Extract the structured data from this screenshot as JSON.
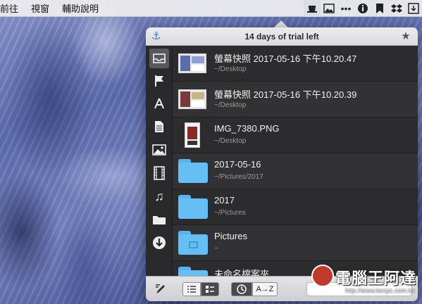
{
  "menubar": {
    "items": [
      "前往",
      "視窗",
      "輔助說明"
    ],
    "status_icons": [
      "hat-icon",
      "image-icon",
      "more-icon",
      "info-icon",
      "bookmark-icon",
      "dropbox-icon",
      "download-icon"
    ]
  },
  "popover": {
    "title": "14 days of trial left",
    "sidebar": [
      "tray-icon",
      "flag-icon",
      "apps-icon",
      "document-icon",
      "picture-icon",
      "film-icon",
      "music-icon",
      "folder-icon",
      "download-icon"
    ],
    "rows": [
      {
        "name": "螢幕快照 2017-05-16 下午10.20.47",
        "path": "~/Desktop",
        "thumb": "screenshot"
      },
      {
        "name": "螢幕快照 2017-05-16 下午10.20.39",
        "path": "~/Desktop",
        "thumb": "screenshot"
      },
      {
        "name": "IMG_7380.PNG",
        "path": "~/Desktop",
        "thumb": "portrait-image"
      },
      {
        "name": "2017-05-16",
        "path": "~/Pictures/2017",
        "thumb": "folder"
      },
      {
        "name": "2017",
        "path": "~/Pictures",
        "thumb": "folder"
      },
      {
        "name": "Pictures",
        "path": "~",
        "thumb": "pictures-folder"
      },
      {
        "name": "未命名檔案夾",
        "path": "",
        "thumb": "folder"
      }
    ],
    "toolbar": {
      "sort_label": "A→Z"
    }
  },
  "watermark": {
    "text": "電腦王阿達",
    "url": "http://www.kocpc.com.tw"
  },
  "colors": {
    "accent": "#2f7fd1",
    "folder": "#64bff5",
    "panel": "#2c2c2e"
  }
}
